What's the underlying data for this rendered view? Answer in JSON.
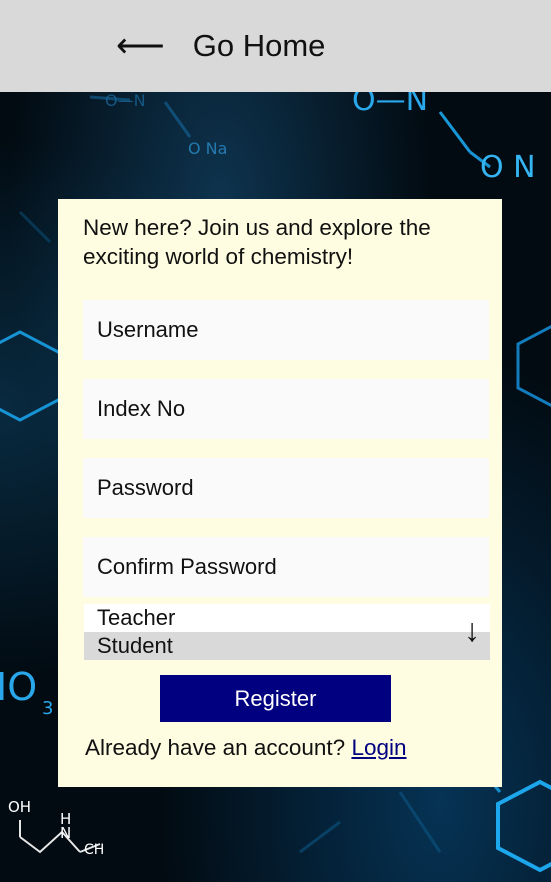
{
  "header": {
    "back_icon": "left-arrow-icon",
    "back_arrow": "⟵",
    "back_label": "Go Home"
  },
  "form": {
    "intro": "New here? Join us and explore the exciting world of chemistry!",
    "username_placeholder": "Username",
    "index_placeholder": "Index No",
    "password_placeholder": "Password",
    "confirm_placeholder": "Confirm Password",
    "roles": [
      "Teacher",
      "Student"
    ],
    "selected_role": "Student",
    "role_arrow": "↓",
    "register_label": "Register",
    "already_text": "Already have an account?",
    "login_label": "Login"
  },
  "background": {
    "formula_labels": [
      "O—N",
      "O—N",
      "O Na",
      "O N",
      "IO",
      "3",
      "OH",
      "H",
      "N",
      "CH"
    ]
  },
  "colors": {
    "header_bg": "#d9d9d9",
    "card_bg": "#fffde1",
    "button_bg": "#000080",
    "link": "#000080"
  }
}
